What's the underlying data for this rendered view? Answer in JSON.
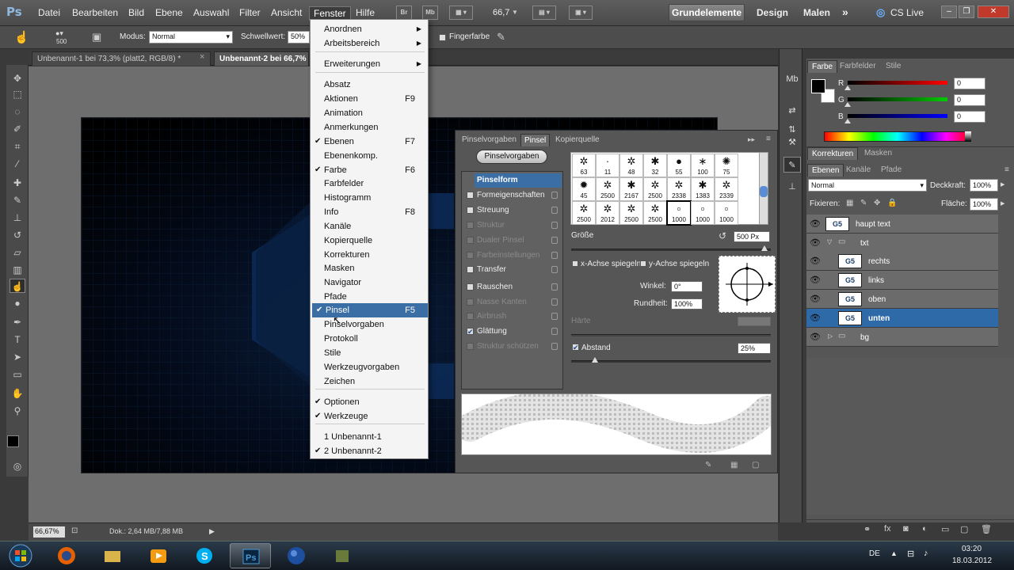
{
  "app": {
    "logo": "Ps"
  },
  "menubar": {
    "items": [
      "Datei",
      "Bearbeiten",
      "Bild",
      "Ebene",
      "Auswahl",
      "Filter",
      "Ansicht",
      "Fenster",
      "Hilfe"
    ],
    "zoom": "66,7",
    "zoom_arrow": "▼",
    "bridge": "Br",
    "minibridge": "Mb",
    "workspaces": {
      "active": "Grundelemente",
      "design": "Design",
      "painting": "Malen",
      "more": "»"
    },
    "cslive": "CS Live"
  },
  "options": {
    "brush_size": "500",
    "mode_label": "Modus:",
    "mode_value": "Normal",
    "threshold_label": "Schwellwert:",
    "threshold_value": "50%",
    "finger_label": "Fingerfarbe"
  },
  "tabs": [
    {
      "label": "Unbenannt-1 bei 73,3% (platt2, RGB/8) *",
      "close": "×"
    },
    {
      "label": "Unbenannt-2 bei 66,7%"
    }
  ],
  "dropdown": {
    "items": [
      {
        "label": "Anordnen",
        "arrow": "▶"
      },
      {
        "label": "Arbeitsbereich",
        "arrow": "▶"
      },
      {
        "label": "Erweiterungen",
        "arrow": "▶"
      },
      {
        "label": "Absatz"
      },
      {
        "label": "Aktionen",
        "shortcut": "F9"
      },
      {
        "label": "Animation"
      },
      {
        "label": "Anmerkungen"
      },
      {
        "label": "Ebenen",
        "shortcut": "F7",
        "check": "✔"
      },
      {
        "label": "Ebenenkomp."
      },
      {
        "label": "Farbe",
        "shortcut": "F6",
        "check": "✔"
      },
      {
        "label": "Farbfelder"
      },
      {
        "label": "Histogramm"
      },
      {
        "label": "Info",
        "shortcut": "F8"
      },
      {
        "label": "Kanäle"
      },
      {
        "label": "Kopierquelle"
      },
      {
        "label": "Korrekturen"
      },
      {
        "label": "Masken"
      },
      {
        "label": "Navigator"
      },
      {
        "label": "Pfade"
      },
      {
        "label": "Pinsel",
        "shortcut": "F5",
        "check": "✔"
      },
      {
        "label": "Pinselvorgaben"
      },
      {
        "label": "Protokoll"
      },
      {
        "label": "Stile"
      },
      {
        "label": "Werkzeugvorgaben"
      },
      {
        "label": "Zeichen"
      },
      {
        "label": "Optionen",
        "check": "✔"
      },
      {
        "label": "Werkzeuge",
        "check": "✔"
      },
      {
        "label": "1 Unbenannt-1"
      },
      {
        "label": "2 Unbenannt-2",
        "check": "✔"
      }
    ]
  },
  "brush_panel": {
    "tabs": [
      "Pinselvorgaben",
      "Pinsel",
      "Kopierquelle"
    ],
    "presets_button": "Pinselvorgaben",
    "brush_tip_head": "Pinselform",
    "left_items": [
      {
        "label": "Formeigenschaften"
      },
      {
        "label": "Streuung"
      },
      {
        "label": "Struktur"
      },
      {
        "label": "Dualer Pinsel"
      },
      {
        "label": "Farbeinstellungen"
      },
      {
        "label": "Transfer"
      },
      {
        "label": "Rauschen"
      },
      {
        "label": "Nasse Kanten"
      },
      {
        "label": "Airbrush"
      },
      {
        "label": "Glättung",
        "check": "✔"
      },
      {
        "label": "Struktur schützen"
      }
    ],
    "brush_sizes": [
      "63",
      "11",
      "48",
      "32",
      "55",
      "100",
      "75",
      "45",
      "2500",
      "2167",
      "2500",
      "2338",
      "1383",
      "2339",
      "2500",
      "2012",
      "2500",
      "2500",
      "1000",
      "1000",
      "1000"
    ],
    "size_label": "Größe",
    "size_value": "500 Px",
    "flip_x": "x-Achse spiegeln",
    "flip_y": "y-Achse spiegeln",
    "angle_label": "Winkel:",
    "angle_value": "0°",
    "roundness_label": "Rundheit:",
    "roundness_value": "100%",
    "hardness_label": "Härte",
    "spacing_label": "Abstand",
    "spacing_check": "✔",
    "spacing_value": "25%",
    "size_level": 0.97,
    "spacing_level": 0.12
  },
  "color_panel": {
    "tabs": [
      "Farbe",
      "Farbfelder",
      "Stile"
    ],
    "channels": [
      {
        "label": "R",
        "value": "0",
        "color": "#ff0000"
      },
      {
        "label": "G",
        "value": "0",
        "color": "#00cc00"
      },
      {
        "label": "B",
        "value": "0",
        "color": "#0000ff"
      }
    ]
  },
  "layers_panel": {
    "top_tabs": [
      "Korrekturen",
      "Masken"
    ],
    "tabs": [
      "Ebenen",
      "Kanäle",
      "Pfade"
    ],
    "blend_mode": "Normal",
    "opacity_label": "Deckkraft:",
    "opacity_value": "100%",
    "lock_label": "Fixieren:",
    "fill_label": "Fläche:",
    "fill_value": "100%",
    "thumb_text": "G5",
    "layers": [
      {
        "name": "haupt text"
      },
      {
        "name": "txt"
      },
      {
        "name": "rechts"
      },
      {
        "name": "links"
      },
      {
        "name": "oben"
      },
      {
        "name": "unten"
      },
      {
        "name": "bg"
      }
    ]
  },
  "status": {
    "zoom": "66,67%",
    "doc": "Dok.: 2,64 MB/7,88 MB"
  },
  "taskbar": {
    "lang": "DE",
    "time": "03:20",
    "date": "18.03.2012"
  },
  "colors": {
    "accent": "#3a6ea5",
    "selected_layer": "#2e6aa8"
  }
}
